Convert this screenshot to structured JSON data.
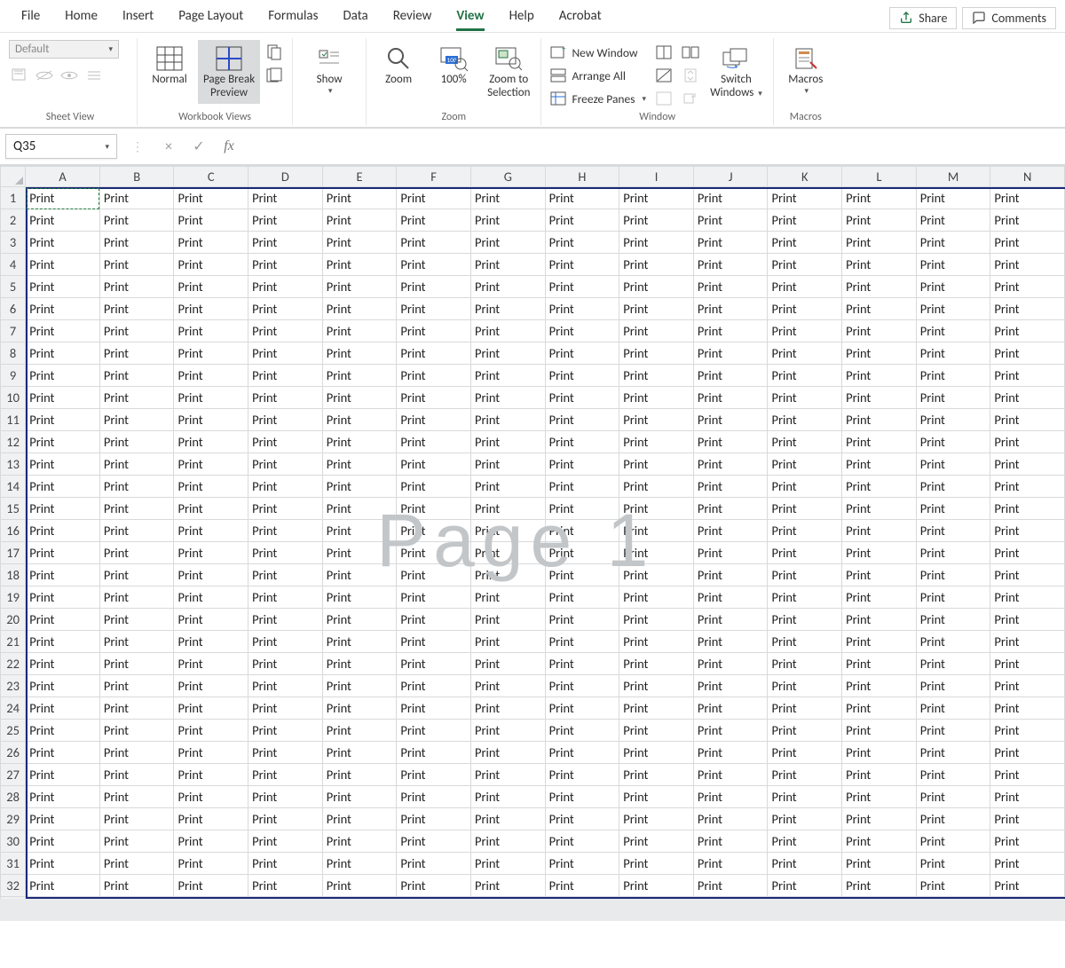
{
  "tabs": {
    "file": "File",
    "home": "Home",
    "insert": "Insert",
    "pagelayout": "Page Layout",
    "formulas": "Formulas",
    "data": "Data",
    "review": "Review",
    "view": "View",
    "help": "Help",
    "acrobat": "Acrobat",
    "active": "view"
  },
  "topright": {
    "share": "Share",
    "comments": "Comments"
  },
  "ribbon": {
    "sheetview": {
      "default": "Default",
      "group": "Sheet View"
    },
    "workbook": {
      "normal": "Normal",
      "pagebreak_l1": "Page Break",
      "pagebreak_l2": "Preview",
      "group": "Workbook Views"
    },
    "show": {
      "label": "Show"
    },
    "zoom": {
      "zoom": "Zoom",
      "hundred": "100%",
      "selection_l1": "Zoom to",
      "selection_l2": "Selection",
      "group": "Zoom"
    },
    "window": {
      "newwin": "New Window",
      "arrange": "Arrange All",
      "freeze": "Freeze Panes",
      "switch_l1": "Switch",
      "switch_l2": "Windows",
      "group": "Window"
    },
    "macros": {
      "label": "Macros",
      "group": "Macros"
    }
  },
  "formula_bar": {
    "namebox": "Q35",
    "fx": "fx",
    "value": ""
  },
  "grid": {
    "columns": [
      "A",
      "B",
      "C",
      "D",
      "E",
      "F",
      "G",
      "H",
      "I",
      "J",
      "K",
      "L",
      "M",
      "N"
    ],
    "row_count": 33,
    "filled_rows": 32,
    "cell_value": "Print",
    "watermark": "Page 1"
  }
}
